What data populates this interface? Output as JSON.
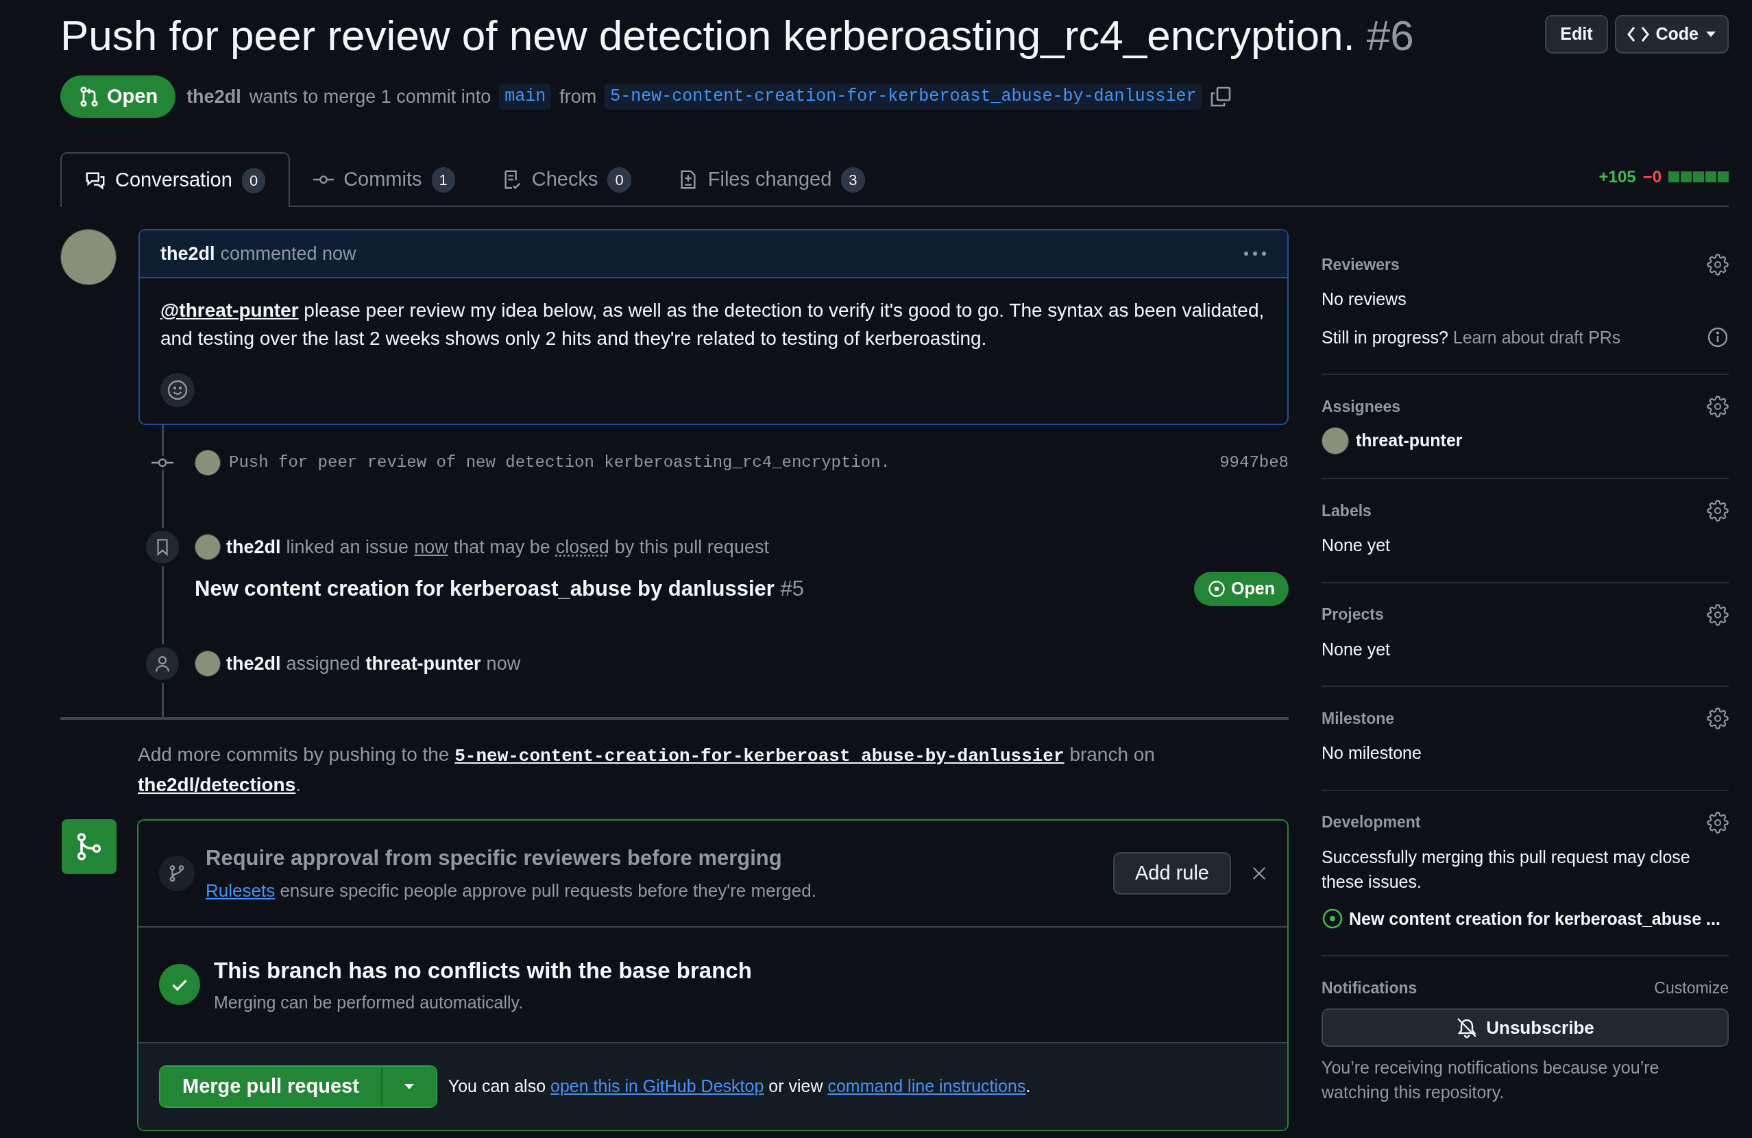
{
  "header": {
    "title": "Push for peer review of new detection kerberoasting_rc4_encryption.",
    "number": "#6",
    "actions": [
      {
        "kind": "edit",
        "label": "Edit"
      },
      {
        "kind": "code",
        "label": "Code"
      }
    ]
  },
  "meta": {
    "state": "Open",
    "author": "the2dl",
    "text": "wants to merge 1 commit into",
    "base": "main",
    "from": "from",
    "head": "5-new-content-creation-for-kerberoast_abuse-by-danlussier"
  },
  "tabs": [
    {
      "kind": "conversation",
      "label": "Conversation",
      "count": "0",
      "selected": true
    },
    {
      "kind": "commits",
      "label": "Commits",
      "count": "1",
      "selected": false
    },
    {
      "kind": "checks",
      "label": "Checks",
      "count": "0",
      "selected": false
    },
    {
      "kind": "files",
      "label": "Files changed",
      "count": "3",
      "selected": false
    }
  ],
  "diffstat": {
    "additions": "+105",
    "deletions": "−0"
  },
  "comment": {
    "author": "the2dl",
    "action": "commented now",
    "mention": "@threat-punter",
    "body": "please peer review my idea below, as well as the detection to verify it's good to go. The syntax as been validated, and testing over the last 2 weeks shows only 2 hits and they're related to testing of kerberoasting."
  },
  "timeline": [
    {
      "kind": "commit",
      "message": "Push for peer review of new detection kerberoasting_rc4_encryption.",
      "hash": "9947be8"
    },
    {
      "kind": "linked_issue",
      "actor": "the2dl",
      "text_1": "linked an issue",
      "link_1": "now",
      "text_2": "that may be",
      "link_2": "closed",
      "text_3": "by this pull request",
      "issue_title": "New content creation for kerberoast_abuse by danlussier",
      "issue_number": "#5",
      "issue_state": "Open"
    },
    {
      "kind": "assigned",
      "actor": "the2dl",
      "text_1": "assigned",
      "assignee": "threat-punter",
      "time": "now"
    }
  ],
  "push_note": {
    "text_1": "Add more commits by pushing to the",
    "branch": "5-new-content-creation-for-kerberoast_abuse-by-danlussier",
    "text_2": "branch on",
    "repo": "the2dl/detections",
    "end": "."
  },
  "merge_box": {
    "ruleset": {
      "title": "Require approval from specific reviewers before merging",
      "link": "Rulesets",
      "text": "ensure specific people approve pull requests before they're merged.",
      "button": "Add rule"
    },
    "status": {
      "title": "This branch has no conflicts with the base branch",
      "subtitle": "Merging can be performed automatically."
    },
    "merge_button": "Merge pull request",
    "also": {
      "text_1": "You can also",
      "link_1": "open this in GitHub Desktop",
      "text_2": "or view",
      "link_2": "command line instructions",
      "end": "."
    }
  },
  "sidebar": {
    "sections": [
      {
        "kind": "reviewers",
        "title": "Reviewers",
        "value": "No reviews",
        "hint": "Still in progress?",
        "hint_link": "Learn about draft PRs"
      },
      {
        "kind": "assignees",
        "title": "Assignees",
        "value": "threat-punter"
      },
      {
        "kind": "plain",
        "title": "Labels",
        "value": "None yet"
      },
      {
        "kind": "plain",
        "title": "Projects",
        "value": "None yet"
      },
      {
        "kind": "plain",
        "title": "Milestone",
        "value": "No milestone"
      },
      {
        "kind": "development",
        "title": "Development",
        "value": "Successfully merging this pull request may close these issues.",
        "issue": "New content creation for kerberoast_abuse ..."
      },
      {
        "kind": "notifications",
        "title": "Notifications",
        "action": "Customize",
        "button": "Unsubscribe",
        "value": "You’re receiving notifications because you’re watching this repository."
      }
    ]
  }
}
